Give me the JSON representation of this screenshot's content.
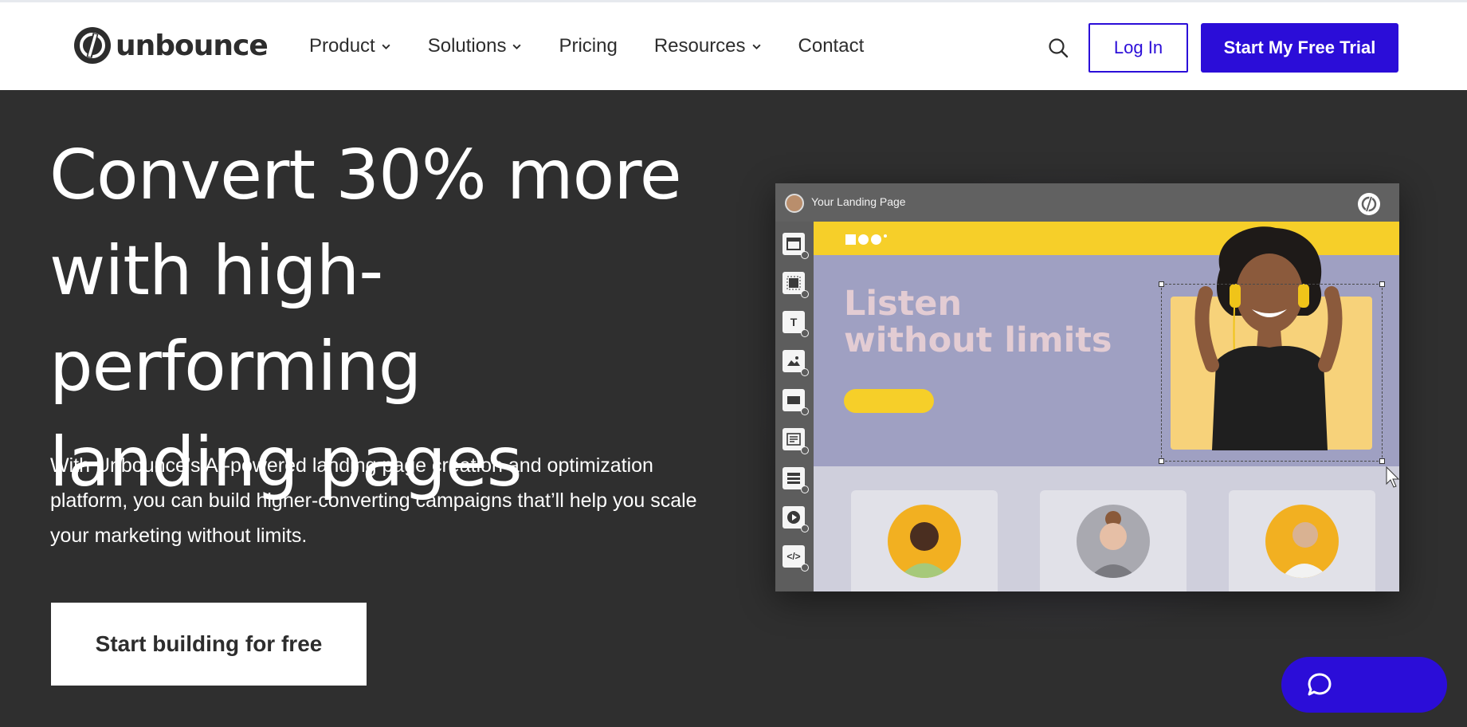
{
  "header": {
    "logo_text": "unbounce",
    "nav": [
      {
        "label": "Product",
        "has_dropdown": true
      },
      {
        "label": "Solutions",
        "has_dropdown": true
      },
      {
        "label": "Pricing",
        "has_dropdown": false
      },
      {
        "label": "Resources",
        "has_dropdown": true
      },
      {
        "label": "Contact",
        "has_dropdown": false
      }
    ],
    "search_icon": "search-icon",
    "login_label": "Log In",
    "trial_label": "Start My Free Trial"
  },
  "hero": {
    "title_lines": [
      "Convert 30% more",
      "with high-performing",
      "landing pages"
    ],
    "subtitle": "With Unbounce’s AI-powered landing page creation and optimization platform, you can build higher-converting campaigns that’ll help you scale your marketing without limits.",
    "cta_label": "Start building for free"
  },
  "mockup": {
    "window_title": "Your Landing Page",
    "headline_lines": [
      "Listen",
      "without limits"
    ],
    "tools": [
      {
        "icon": "section-icon",
        "glyph": ""
      },
      {
        "icon": "box-icon",
        "glyph": ""
      },
      {
        "icon": "text-icon",
        "glyph": "T"
      },
      {
        "icon": "image-icon",
        "glyph": ""
      },
      {
        "icon": "button-icon",
        "glyph": ""
      },
      {
        "icon": "form-icon",
        "glyph": ""
      },
      {
        "icon": "list-icon",
        "glyph": ""
      },
      {
        "icon": "video-icon",
        "glyph": ""
      },
      {
        "icon": "code-icon",
        "glyph": "</>"
      }
    ]
  },
  "colors": {
    "brand": "#2b0dd8",
    "hero_bg": "#2f2f2f",
    "accent_yellow": "#f6cf29",
    "mock_panel": "#9fa0c2"
  },
  "chat": {
    "icon": "chat-bubble-icon"
  }
}
